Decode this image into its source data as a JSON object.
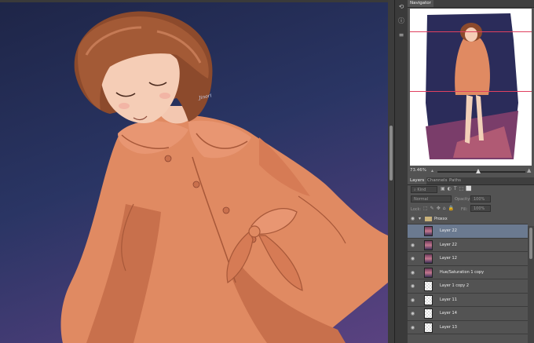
{
  "canvas": {
    "signature": "Jinori"
  },
  "panels": {
    "navigator": {
      "tab": "Navigator",
      "zoom": "73.46%"
    },
    "layers": {
      "tabs": [
        "Layers",
        "Channels",
        "Paths"
      ],
      "filter_kind": "Kind",
      "blend_mode": "Normal",
      "opacity_label": "Opacity:",
      "opacity_value": "100%",
      "lock_label": "Lock:",
      "fill_label": "Fill:",
      "fill_value": "100%",
      "group_name": "Proxxx",
      "rows": [
        {
          "name": "Layer 22",
          "thumb": "art",
          "selected": true
        },
        {
          "name": "Layer 22",
          "thumb": "art",
          "selected": false
        },
        {
          "name": "Layer 12",
          "thumb": "art",
          "selected": false
        },
        {
          "name": "Hue/Saturation 1 copy",
          "thumb": "art",
          "selected": false
        },
        {
          "name": "Layer 1 copy 2",
          "thumb": "checker",
          "selected": false
        },
        {
          "name": "Layer 11",
          "thumb": "checker",
          "selected": false
        },
        {
          "name": "Layer 14",
          "thumb": "checker",
          "selected": false
        },
        {
          "name": "Layer 13",
          "thumb": "checker",
          "selected": false
        }
      ]
    }
  }
}
